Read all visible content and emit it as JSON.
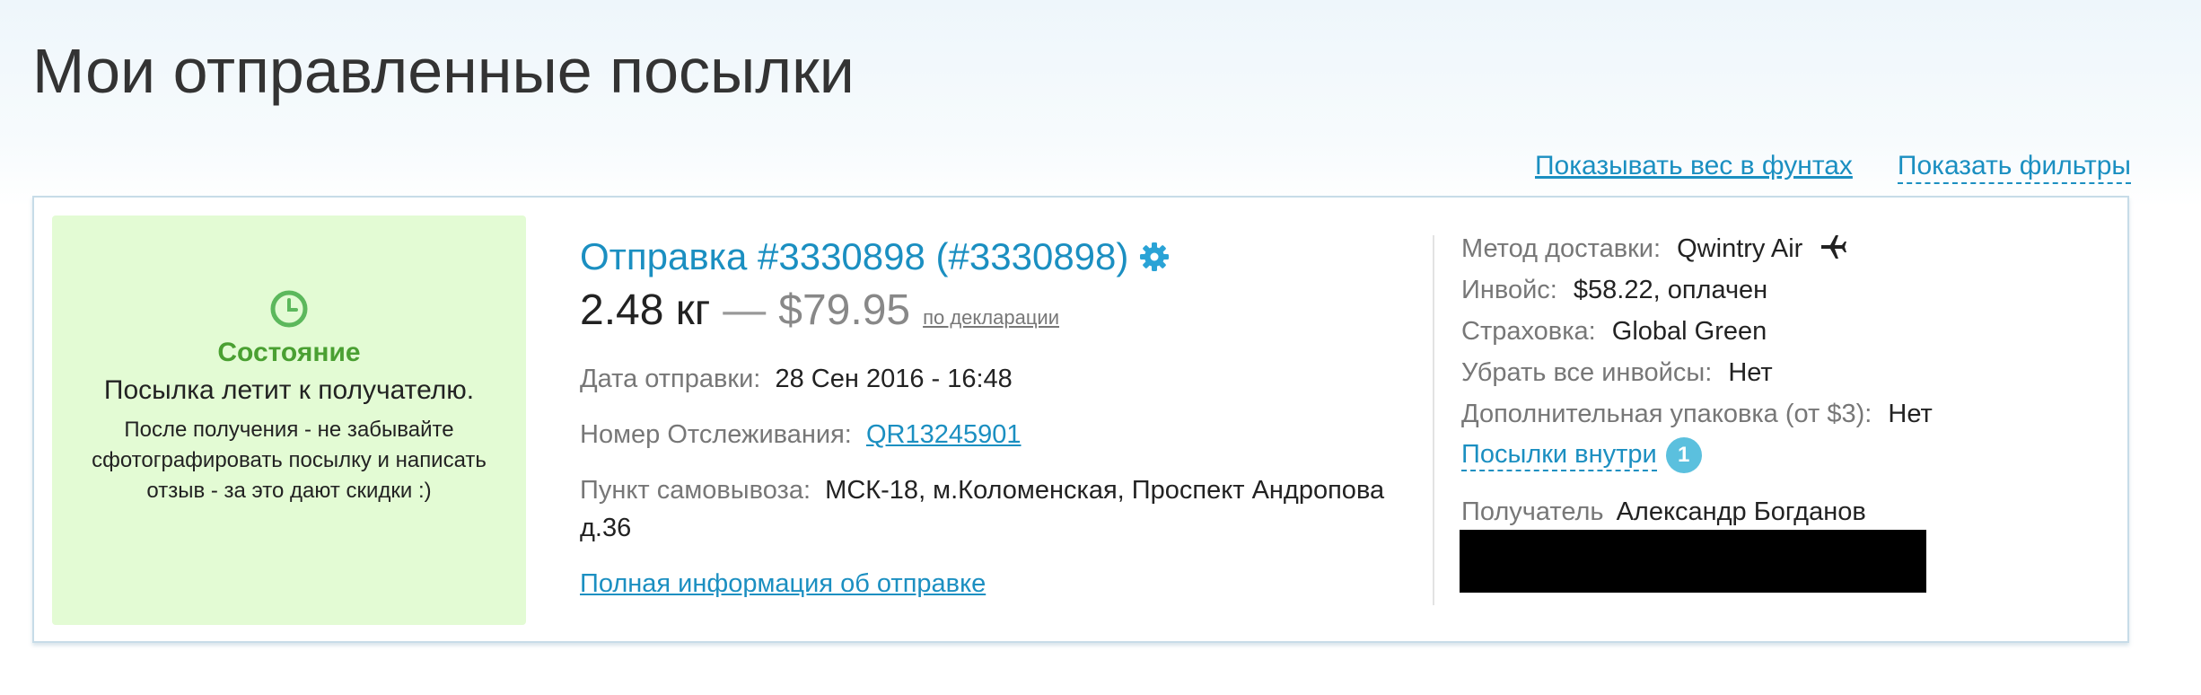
{
  "page": {
    "title": "Мои отправленные посылки"
  },
  "top_links": {
    "show_weight_lbs": "Показывать вес в фунтах",
    "show_filters": "Показать фильтры"
  },
  "shipment": {
    "status": {
      "title": "Состояние",
      "text": "Посылка летит к получателю.",
      "note": "После получения - не забывайте сфотографировать посылку и написать отзыв - за это дают скидки :)"
    },
    "title": "Отправка #3330898 (#3330898)",
    "weight": "2.48 кг",
    "dash": "—",
    "price": "$79.95",
    "declaration_link": "по декларации",
    "fields": {
      "ship_date_label": "Дата отправки:",
      "ship_date_value": "28 Сен 2016 - 16:48",
      "tracking_label": "Номер Отслеживания:",
      "tracking_value": "QR13245901",
      "pickup_label": "Пункт самовывоза:",
      "pickup_value": "МСК-18, м.Коломенская, Проспект Андропова д.36"
    },
    "full_info_link": "Полная информация об отправке",
    "details": {
      "delivery_method_label": "Метод доставки:",
      "delivery_method_value": "Qwintry Air",
      "invoice_label": "Инвойс:",
      "invoice_value": "$58.22, оплачен",
      "insurance_label": "Страховка:",
      "insurance_value": "Global Green",
      "remove_invoices_label": "Убрать все инвойсы:",
      "remove_invoices_value": "Нет",
      "extra_packing_label": "Дополнительная упаковка (от $3):",
      "extra_packing_value": "Нет",
      "parcels_inside_link": "Посылки внутри",
      "parcels_inside_count": "1",
      "recipient_label": "Получатель",
      "recipient_value": "Александр Богданов"
    }
  },
  "colors": {
    "accent": "#1b8fc1",
    "status_bg": "#e3fbd4",
    "status_green": "#4aa032",
    "badge": "#5bc0de"
  },
  "icons": {
    "status": "clock-icon",
    "settings": "gear-icon",
    "delivery": "plane-icon"
  }
}
